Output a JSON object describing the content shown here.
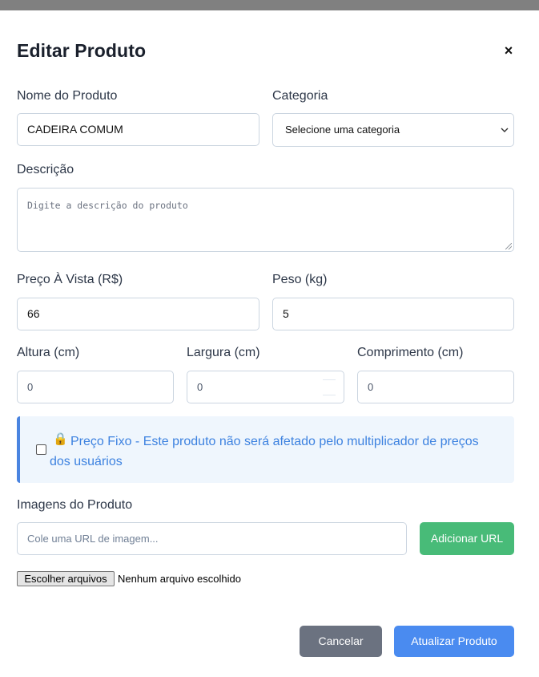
{
  "modal": {
    "title": "Editar Produto",
    "close_symbol": "×"
  },
  "form": {
    "name": {
      "label": "Nome do Produto",
      "value": "CADEIRA COMUM"
    },
    "category": {
      "label": "Categoria",
      "selected": "Selecione uma categoria",
      "icon": "chevron-down-icon"
    },
    "description": {
      "label": "Descrição",
      "placeholder": "Digite a descrição do produto"
    },
    "price": {
      "label": "Preço À Vista (R$)",
      "value": "66"
    },
    "weight": {
      "label": "Peso (kg)",
      "value": "5"
    },
    "height": {
      "label": "Altura (cm)",
      "value": "0"
    },
    "width": {
      "label": "Largura (cm)",
      "value": "0"
    },
    "length": {
      "label": "Comprimento (cm)",
      "value": "0"
    },
    "fixed_price": {
      "checked": false,
      "icon": "lock-icon",
      "lock_symbol": "🔒",
      "text": "Preço Fixo - Este produto não será afetado pelo multiplicador de preços dos usuários",
      "accent_color": "#4a84e0"
    },
    "images": {
      "label": "Imagens do Produto",
      "url_placeholder": "Cole uma URL de imagem...",
      "add_url_label": "Adicionar URL",
      "file_button_label": "Escolher arquivos",
      "file_status": "Nenhum arquivo escolhido"
    }
  },
  "actions": {
    "cancel_label": "Cancelar",
    "submit_label": "Atualizar Produto"
  },
  "colors": {
    "add_url": "#48bb78",
    "cancel": "#6b7280",
    "submit": "#4a8bf0"
  }
}
